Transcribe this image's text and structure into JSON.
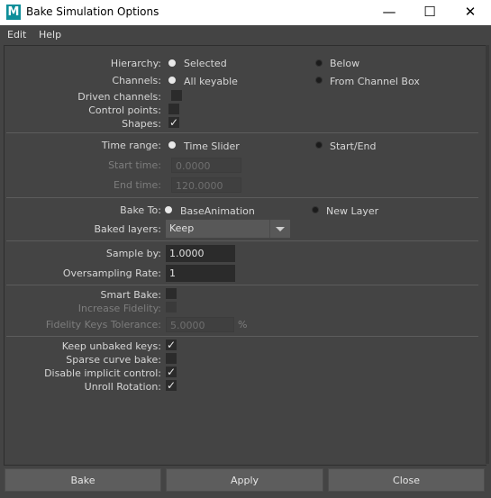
{
  "window": {
    "title": "Bake Simulation Options",
    "app_icon_letter": "M",
    "minimize": "—",
    "maximize": "☐",
    "close": "✕"
  },
  "menu": {
    "items": [
      "Edit",
      "Help"
    ]
  },
  "hierarchy": {
    "label": "Hierarchy:",
    "opt1": "Selected",
    "opt2": "Below",
    "selected": "Selected"
  },
  "channels": {
    "label": "Channels:",
    "opt1": "All keyable",
    "opt2": "From Channel Box",
    "selected": "All keyable"
  },
  "driven_channels": {
    "label": "Driven channels:",
    "checked": false
  },
  "control_points": {
    "label": "Control points:",
    "checked": false
  },
  "shapes": {
    "label": "Shapes:",
    "checked": true
  },
  "time_range": {
    "label": "Time range:",
    "opt1": "Time Slider",
    "opt2": "Start/End",
    "selected": "Time Slider"
  },
  "start_time": {
    "label": "Start time:",
    "value": "0.0000"
  },
  "end_time": {
    "label": "End time:",
    "value": "120.0000"
  },
  "bake_to": {
    "label": "Bake To:",
    "opt1": "BaseAnimation",
    "opt2": "New Layer",
    "selected": "BaseAnimation"
  },
  "baked_layers": {
    "label": "Baked layers:",
    "value": "Keep"
  },
  "sample_by": {
    "label": "Sample by:",
    "value": "1.0000"
  },
  "oversampling": {
    "label": "Oversampling Rate:",
    "value": "1"
  },
  "smart_bake": {
    "label": "Smart Bake:",
    "checked": false
  },
  "increase_fidelity": {
    "label": "Increase Fidelity:",
    "checked": false
  },
  "fidelity_tolerance": {
    "label": "Fidelity Keys Tolerance:",
    "value": "5.0000",
    "unit": "%"
  },
  "keep_unbaked": {
    "label": "Keep unbaked keys:",
    "checked": true
  },
  "sparse_curve": {
    "label": "Sparse curve bake:",
    "checked": false
  },
  "disable_implicit": {
    "label": "Disable implicit control:",
    "checked": true
  },
  "unroll_rotation": {
    "label": "Unroll Rotation:",
    "checked": true
  },
  "buttons": {
    "bake": "Bake",
    "apply": "Apply",
    "close": "Close"
  },
  "check_glyph": "✓"
}
